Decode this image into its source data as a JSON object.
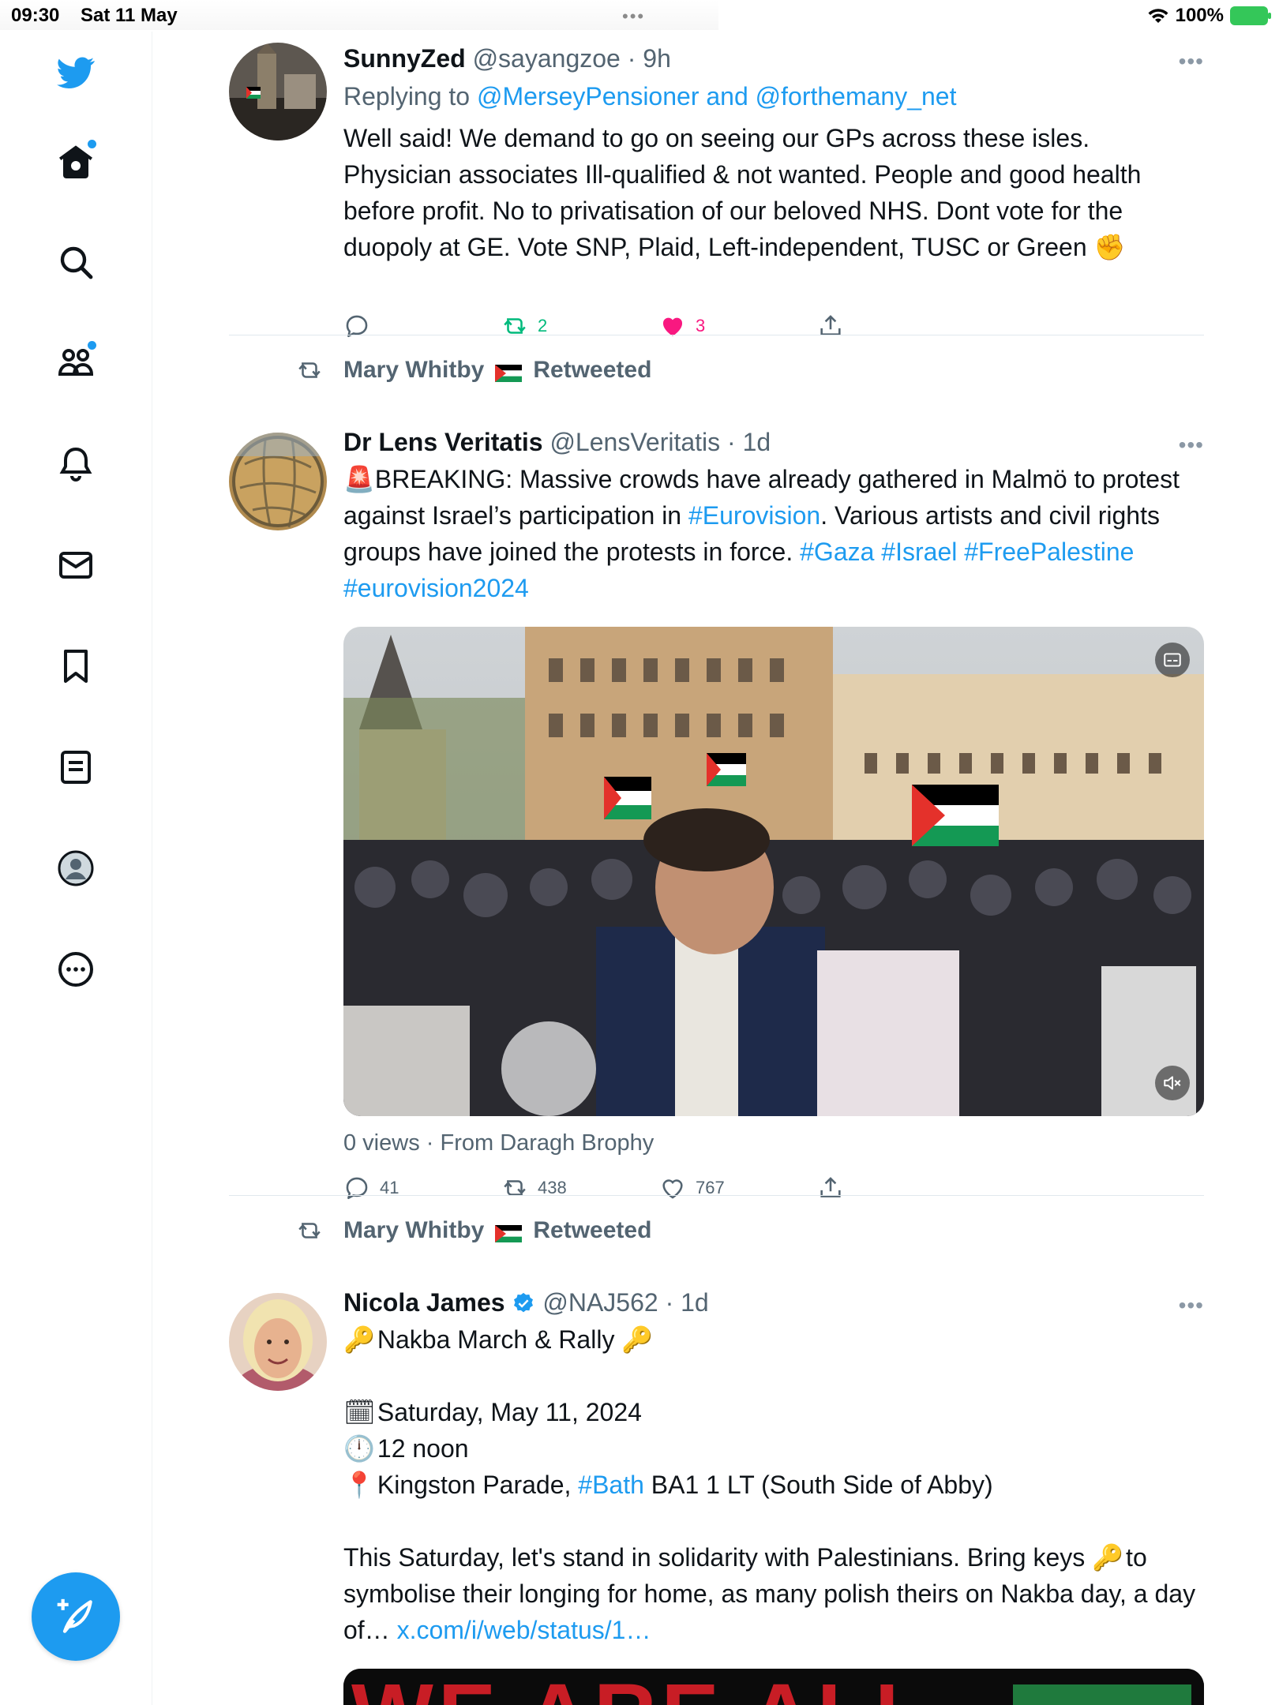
{
  "status_bar": {
    "time": "09:30",
    "date": "Sat 11 May",
    "dots": "•••",
    "battery": "100%"
  },
  "sidebar": {
    "items": [
      {
        "name": "home",
        "has_dot": true
      },
      {
        "name": "search"
      },
      {
        "name": "communities",
        "has_dot": true
      },
      {
        "name": "notifications"
      },
      {
        "name": "messages"
      },
      {
        "name": "bookmarks"
      },
      {
        "name": "lists"
      },
      {
        "name": "profile"
      },
      {
        "name": "more"
      }
    ]
  },
  "tweets": [
    {
      "name": "SunnyZed",
      "handle": "@sayangzoe",
      "sep": "·",
      "time": "9h",
      "more": "•••",
      "reply_prefix": "Replying to ",
      "reply_user1": "@MerseyPensioner",
      "reply_and": " and ",
      "reply_user2": "@forthemany_net",
      "text": "Well said! We demand to go on seeing our GPs across these isles. Physician associates Ill-qualified & not wanted. People and good health before profit. No to privatisation of our beloved NHS. Dont vote for the duopoly at GE. Vote SNP, Plaid, Left-independent, TUSC or Green",
      "text_emoji": "✊",
      "replies": "",
      "retweets": "2",
      "likes": "3"
    },
    {
      "retweeted_by": "Mary Whitby",
      "retweeted_label": "Retweeted",
      "name": "Dr Lens Veritatis",
      "handle": "@LensVeritatis",
      "sep": "·",
      "time": "1d",
      "more": "•••",
      "text_emoji": "🚨",
      "text_1": "BREAKING: Massive crowds have already gathered in Malmö to protest against Israel’s participation in ",
      "tag_eurovision": "#Eurovision",
      "text_2": ". Various artists and civil rights groups have joined the protests in force. ",
      "tag_gaza": "#Gaza",
      "tag_israel": "#Israel",
      "tag_free": "#FreePalestine",
      "tag_euro2024": "#eurovision2024",
      "views": "0 views",
      "from": "· From Daragh Brophy",
      "replies": "41",
      "retweets": "438",
      "likes": "767"
    },
    {
      "retweeted_by": "Mary Whitby",
      "retweeted_label": "Retweeted",
      "name": "Nicola James",
      "handle": "@NAJ562",
      "sep": "·",
      "time": "1d",
      "more": "•••",
      "line_1": "Nakba March & Rally",
      "line_date": "Saturday, May 11, 2024",
      "line_time": "12 noon",
      "line_place_1": "Kingston Parade, ",
      "tag_bath": "#Bath",
      "line_place_2": " BA1 1 LT (South Side of Abby)",
      "para_1": "This Saturday, let's stand in solidarity with Palestinians. Bring keys",
      "para_2": "to symbolise their longing for home, as many polish theirs on Nakba day, a day of… ",
      "link": "x.com/i/web/status/1…",
      "banner_text": "WE ARE ALL"
    }
  ]
}
